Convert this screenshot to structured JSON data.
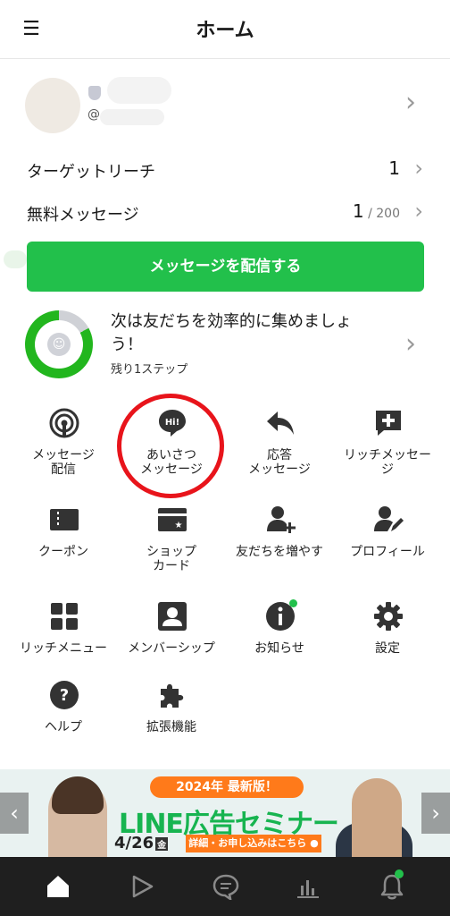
{
  "header": {
    "title": "ホーム",
    "menu_icon": "hamburger-icon"
  },
  "profile": {
    "at_prefix": "@"
  },
  "stats": [
    {
      "label": "ターゲットリーチ",
      "value": "1",
      "sub": ""
    },
    {
      "label": "無料メッセージ",
      "value": "1",
      "sub": " / 200"
    }
  ],
  "cta": {
    "label": "メッセージを配信する"
  },
  "steps": {
    "text": "次は友だちを効率的に集めましょう！",
    "remaining": "残り1ステップ",
    "progress_percent": 83
  },
  "grid": [
    {
      "label": "メッセージ\n配信",
      "icon": "broadcast-icon"
    },
    {
      "label": "あいさつ\nメッセージ",
      "icon": "hi-bubble-icon"
    },
    {
      "label": "応答\nメッセージ",
      "icon": "reply-icon"
    },
    {
      "label": "リッチメッセー\nジ",
      "icon": "rich-message-icon"
    },
    {
      "label": "クーポン",
      "icon": "coupon-icon"
    },
    {
      "label": "ショップ\nカード",
      "icon": "shop-card-icon"
    },
    {
      "label": "友だちを増やす",
      "icon": "add-friend-icon"
    },
    {
      "label": "プロフィール",
      "icon": "profile-edit-icon"
    },
    {
      "label": "リッチメニュー",
      "icon": "rich-menu-icon"
    },
    {
      "label": "メンバーシップ",
      "icon": "membership-icon"
    },
    {
      "label": "お知らせ",
      "icon": "info-icon"
    },
    {
      "label": "設定",
      "icon": "gear-icon"
    },
    {
      "label": "ヘルプ",
      "icon": "help-icon"
    },
    {
      "label": "拡張機能",
      "icon": "puzzle-icon"
    }
  ],
  "banner": {
    "badge": "2024年 最新版！",
    "title": "LINE広告セミナー",
    "date": "4/26",
    "weekday": "金",
    "detail": "詳細・お申し込みはこちら ●"
  },
  "tabbar": [
    {
      "icon": "home-icon"
    },
    {
      "icon": "play-icon"
    },
    {
      "icon": "chat-icon"
    },
    {
      "icon": "chart-icon"
    },
    {
      "icon": "bell-icon"
    }
  ],
  "colors": {
    "accent": "#22c04b",
    "highlight_circle": "#e8141b",
    "tabbar": "#1f1f1f"
  }
}
